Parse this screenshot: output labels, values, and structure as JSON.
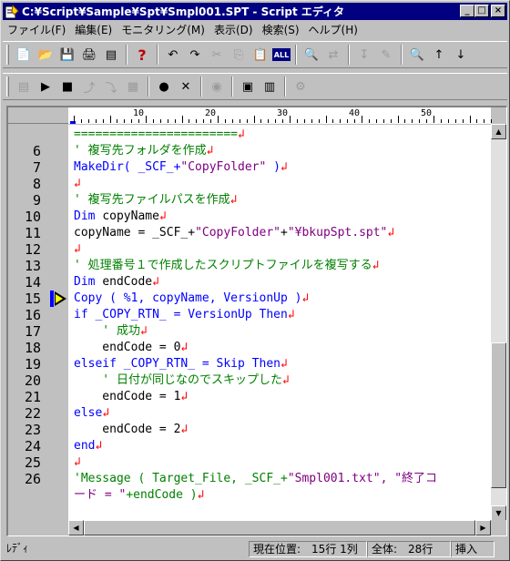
{
  "window": {
    "title": "C:¥Script¥Sample¥Spt¥Smpl001.SPT - Script エディタ",
    "buttons": {
      "minimize": "_",
      "maximize": "□",
      "close": "×"
    }
  },
  "menu": [
    "ファイル(F)",
    "編集(E)",
    "モニタリング(M)",
    "表示(D)",
    "検索(S)",
    "ヘルプ(H)"
  ],
  "toolbar1": [
    {
      "name": "new-file-icon",
      "glyph": "📄"
    },
    {
      "name": "open-file-icon",
      "glyph": "📂"
    },
    {
      "name": "save-file-icon",
      "glyph": "💾"
    },
    {
      "name": "print-icon",
      "glyph": "🖨"
    },
    {
      "name": "properties-icon",
      "glyph": "▤"
    },
    {
      "name": "help-icon",
      "glyph": "?"
    },
    {
      "name": "undo-icon",
      "glyph": "↶"
    },
    {
      "name": "redo-icon",
      "glyph": "↷"
    },
    {
      "name": "cut-icon",
      "glyph": "✂"
    },
    {
      "name": "copy-icon",
      "glyph": "⎘"
    },
    {
      "name": "paste-icon",
      "glyph": "📋"
    },
    {
      "name": "select-all-icon",
      "glyph": "ALL"
    },
    {
      "name": "find-icon",
      "glyph": "🔍"
    },
    {
      "name": "replace-icon",
      "glyph": "⇄"
    },
    {
      "name": "jump-icon",
      "glyph": "↧"
    },
    {
      "name": "edit-icon",
      "glyph": "✎"
    },
    {
      "name": "search-icon",
      "glyph": "🔍"
    },
    {
      "name": "find-next-icon",
      "glyph": "↑"
    },
    {
      "name": "find-prev-icon",
      "glyph": "↓"
    }
  ],
  "toolbar2": [
    {
      "name": "script-run-icon",
      "glyph": "▤"
    },
    {
      "name": "play-icon",
      "glyph": "▶"
    },
    {
      "name": "stop-icon",
      "glyph": "■"
    },
    {
      "name": "step-icon",
      "glyph": "⤴"
    },
    {
      "name": "step-over-icon",
      "glyph": "⤵"
    },
    {
      "name": "monitor-icon",
      "glyph": "▦"
    },
    {
      "name": "breakpoint-set-icon",
      "glyph": "●"
    },
    {
      "name": "breakpoint-clear-icon",
      "glyph": "✕"
    },
    {
      "name": "watch-icon",
      "glyph": "◉"
    },
    {
      "name": "variables-icon",
      "glyph": "▣"
    },
    {
      "name": "log-icon",
      "glyph": "▥"
    },
    {
      "name": "settings-icon",
      "glyph": "⚙"
    }
  ],
  "ruler": {
    "marks": [
      "10",
      "20",
      "30",
      "40",
      "50"
    ]
  },
  "lines": [
    {
      "no": "",
      "segments": [
        {
          "t": "=======================",
          "c": "green"
        },
        {
          "t": "↲",
          "c": "red"
        }
      ]
    },
    {
      "no": "6",
      "segments": [
        {
          "t": "' 複写先フォルダを作成",
          "c": "green"
        },
        {
          "t": "↲",
          "c": "red"
        }
      ]
    },
    {
      "no": "7",
      "segments": [
        {
          "t": "MakeDir( _SCF_+",
          "c": "blue"
        },
        {
          "t": "\"CopyFolder\"",
          "c": "purple"
        },
        {
          "t": " )",
          "c": "blue"
        },
        {
          "t": "↲",
          "c": "red"
        }
      ]
    },
    {
      "no": "8",
      "segments": [
        {
          "t": "↲",
          "c": "red"
        }
      ]
    },
    {
      "no": "9",
      "segments": [
        {
          "t": "' 複写先ファイルパスを作成",
          "c": "green"
        },
        {
          "t": "↲",
          "c": "red"
        }
      ]
    },
    {
      "no": "10",
      "segments": [
        {
          "t": "Dim ",
          "c": "blue"
        },
        {
          "t": "copyName",
          "c": "black"
        },
        {
          "t": "↲",
          "c": "red"
        }
      ]
    },
    {
      "no": "11",
      "segments": [
        {
          "t": "copyName = _SCF_+",
          "c": "black"
        },
        {
          "t": "\"CopyFolder\"",
          "c": "purple"
        },
        {
          "t": "+",
          "c": "black"
        },
        {
          "t": "\"¥bkupSpt.spt\"",
          "c": "purple"
        },
        {
          "t": "↲",
          "c": "red"
        }
      ]
    },
    {
      "no": "12",
      "segments": [
        {
          "t": "↲",
          "c": "red"
        }
      ]
    },
    {
      "no": "13",
      "segments": [
        {
          "t": "' 処理番号１で作成したスクリプトファイルを複写する",
          "c": "green"
        },
        {
          "t": "↲",
          "c": "red"
        }
      ]
    },
    {
      "no": "14",
      "segments": [
        {
          "t": "Dim ",
          "c": "blue"
        },
        {
          "t": "endCode",
          "c": "black"
        },
        {
          "t": "↲",
          "c": "red"
        }
      ]
    },
    {
      "no": "15",
      "segments": [
        {
          "t": "Copy ( %1, copyName, VersionUp )",
          "c": "blue"
        },
        {
          "t": "↲",
          "c": "red"
        }
      ]
    },
    {
      "no": "16",
      "segments": [
        {
          "t": "if ",
          "c": "blue"
        },
        {
          "t": "_COPY_RTN_ = ",
          "c": "blue"
        },
        {
          "t": "VersionUp Then",
          "c": "blue"
        },
        {
          "t": "↲",
          "c": "red"
        }
      ]
    },
    {
      "no": "17",
      "segments": [
        {
          "t": "    ' 成功",
          "c": "green"
        },
        {
          "t": "↲",
          "c": "red"
        }
      ]
    },
    {
      "no": "18",
      "segments": [
        {
          "t": "    endCode = 0",
          "c": "black"
        },
        {
          "t": "↲",
          "c": "red"
        }
      ]
    },
    {
      "no": "19",
      "segments": [
        {
          "t": "elseif _COPY_RTN_ = Skip Then",
          "c": "blue"
        },
        {
          "t": "↲",
          "c": "red"
        }
      ]
    },
    {
      "no": "20",
      "segments": [
        {
          "t": "    ' 日付が同じなのでスキップした",
          "c": "green"
        },
        {
          "t": "↲",
          "c": "red"
        }
      ]
    },
    {
      "no": "21",
      "segments": [
        {
          "t": "    endCode = 1",
          "c": "black"
        },
        {
          "t": "↲",
          "c": "red"
        }
      ]
    },
    {
      "no": "22",
      "segments": [
        {
          "t": "else",
          "c": "blue"
        },
        {
          "t": "↲",
          "c": "red"
        }
      ]
    },
    {
      "no": "23",
      "segments": [
        {
          "t": "    endCode = 2",
          "c": "black"
        },
        {
          "t": "↲",
          "c": "red"
        }
      ]
    },
    {
      "no": "24",
      "segments": [
        {
          "t": "end",
          "c": "blue"
        },
        {
          "t": "↲",
          "c": "red"
        }
      ]
    },
    {
      "no": "25",
      "segments": [
        {
          "t": "↲",
          "c": "red"
        }
      ]
    },
    {
      "no": "26",
      "segments": [
        {
          "t": "'Message ( Target_File, _SCF_+",
          "c": "green"
        },
        {
          "t": "\"Smpl001.txt\"",
          "c": "purple"
        },
        {
          "t": ", \"終了コ",
          "c": "purple"
        }
      ]
    },
    {
      "no": "",
      "segments": [
        {
          "t": "ード = \"",
          "c": "purple"
        },
        {
          "t": "+endCode )",
          "c": "green"
        },
        {
          "t": "↲",
          "c": "red"
        }
      ]
    }
  ],
  "current_line": "15",
  "status": {
    "ready": "ﾚﾃﾞｨ",
    "position": "現在位置:　15行 1列",
    "total": "全体:　28行",
    "mode": "挿入"
  },
  "colors": {
    "titlebar": "#000080",
    "comment": "#008000",
    "keyword": "#0000ff",
    "string": "#800080",
    "linebreak": "#ff0000"
  }
}
